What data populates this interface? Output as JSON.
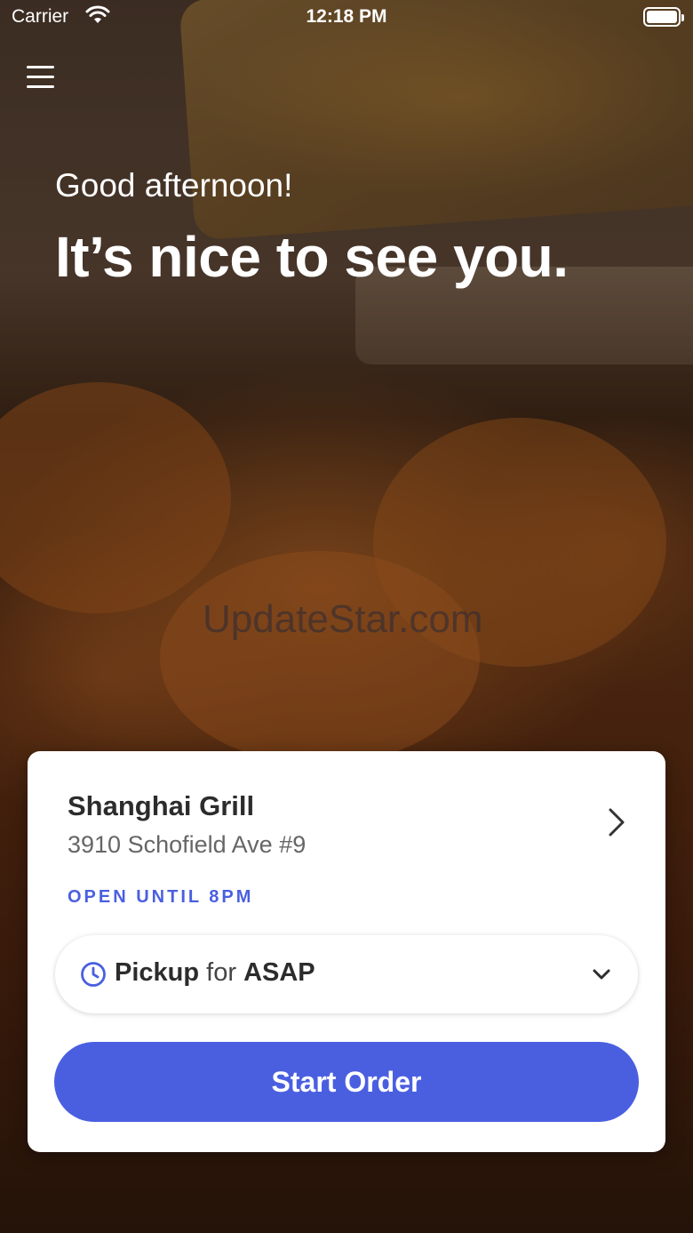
{
  "status_bar": {
    "carrier": "Carrier",
    "time": "12:18 PM",
    "wifi_icon": "wifi-icon",
    "battery_icon": "battery-icon"
  },
  "header": {
    "menu_icon": "hamburger-menu-icon",
    "greeting": "Good afternoon!",
    "headline": "It’s nice to see you."
  },
  "watermark": "UpdateStar.com",
  "store_card": {
    "name": "Shanghai Grill",
    "address": "3910 Schofield Ave #9",
    "status": "OPEN UNTIL 8PM",
    "chevron_icon": "chevron-right-icon",
    "order_type": {
      "icon": "clock-icon",
      "mode": "Pickup",
      "connector": "for",
      "time": "ASAP",
      "dropdown_icon": "chevron-down-icon"
    },
    "start_button": "Start Order"
  },
  "colors": {
    "accent": "#4a5fe0",
    "card_bg": "#ffffff",
    "text_dark": "#2c2c2c",
    "text_muted": "#666666"
  }
}
